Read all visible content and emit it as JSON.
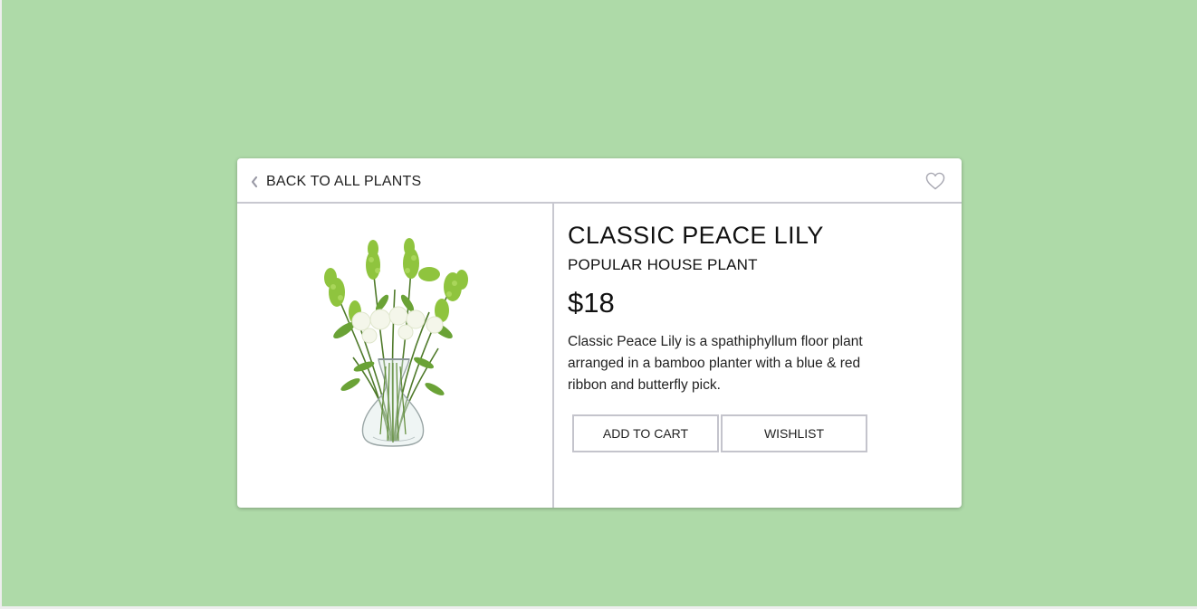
{
  "header": {
    "back_label": "BACK TO ALL PLANTS"
  },
  "product": {
    "name": "CLASSIC PEACE LILY",
    "category": "POPULAR HOUSE PLANT",
    "price": "$18",
    "description": "Classic Peace Lily is a spathiphyllum floor plant arranged in a bamboo planter with a blue & red ribbon and butterfly pick.",
    "image_icon": "flower-vase-image"
  },
  "actions": {
    "add_to_cart_label": "ADD TO CART",
    "wishlist_label": "WISHLIST"
  },
  "colors": {
    "page_background": "#aedaa8",
    "card_background": "#ffffff",
    "divider": "#c8c8d0",
    "button_border": "#c4c4cc"
  }
}
